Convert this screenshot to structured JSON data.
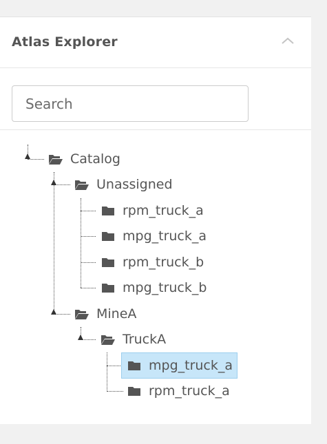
{
  "panel": {
    "title": "Atlas Explorer",
    "collapse_icon": "chevron-up-icon"
  },
  "search": {
    "placeholder": "Search",
    "value": ""
  },
  "tree": {
    "root": {
      "label": "Catalog",
      "icon": "folder-open-icon"
    },
    "unassigned": {
      "label": "Unassigned",
      "icon": "folder-open-icon",
      "children": [
        {
          "label": "rpm_truck_a",
          "icon": "folder-icon"
        },
        {
          "label": "mpg_truck_a",
          "icon": "folder-icon"
        },
        {
          "label": "rpm_truck_b",
          "icon": "folder-icon"
        },
        {
          "label": "mpg_truck_b",
          "icon": "folder-icon"
        }
      ]
    },
    "minea": {
      "label": "MineA",
      "icon": "folder-open-icon"
    },
    "trucka": {
      "label": "TruckA",
      "icon": "folder-open-icon",
      "children": [
        {
          "label": "mpg_truck_a",
          "icon": "folder-icon",
          "selected": true
        },
        {
          "label": "rpm_truck_a",
          "icon": "folder-icon"
        }
      ]
    }
  },
  "colors": {
    "selected_bg": "#c7e6f9",
    "text": "#555555",
    "icon": "#555555"
  }
}
